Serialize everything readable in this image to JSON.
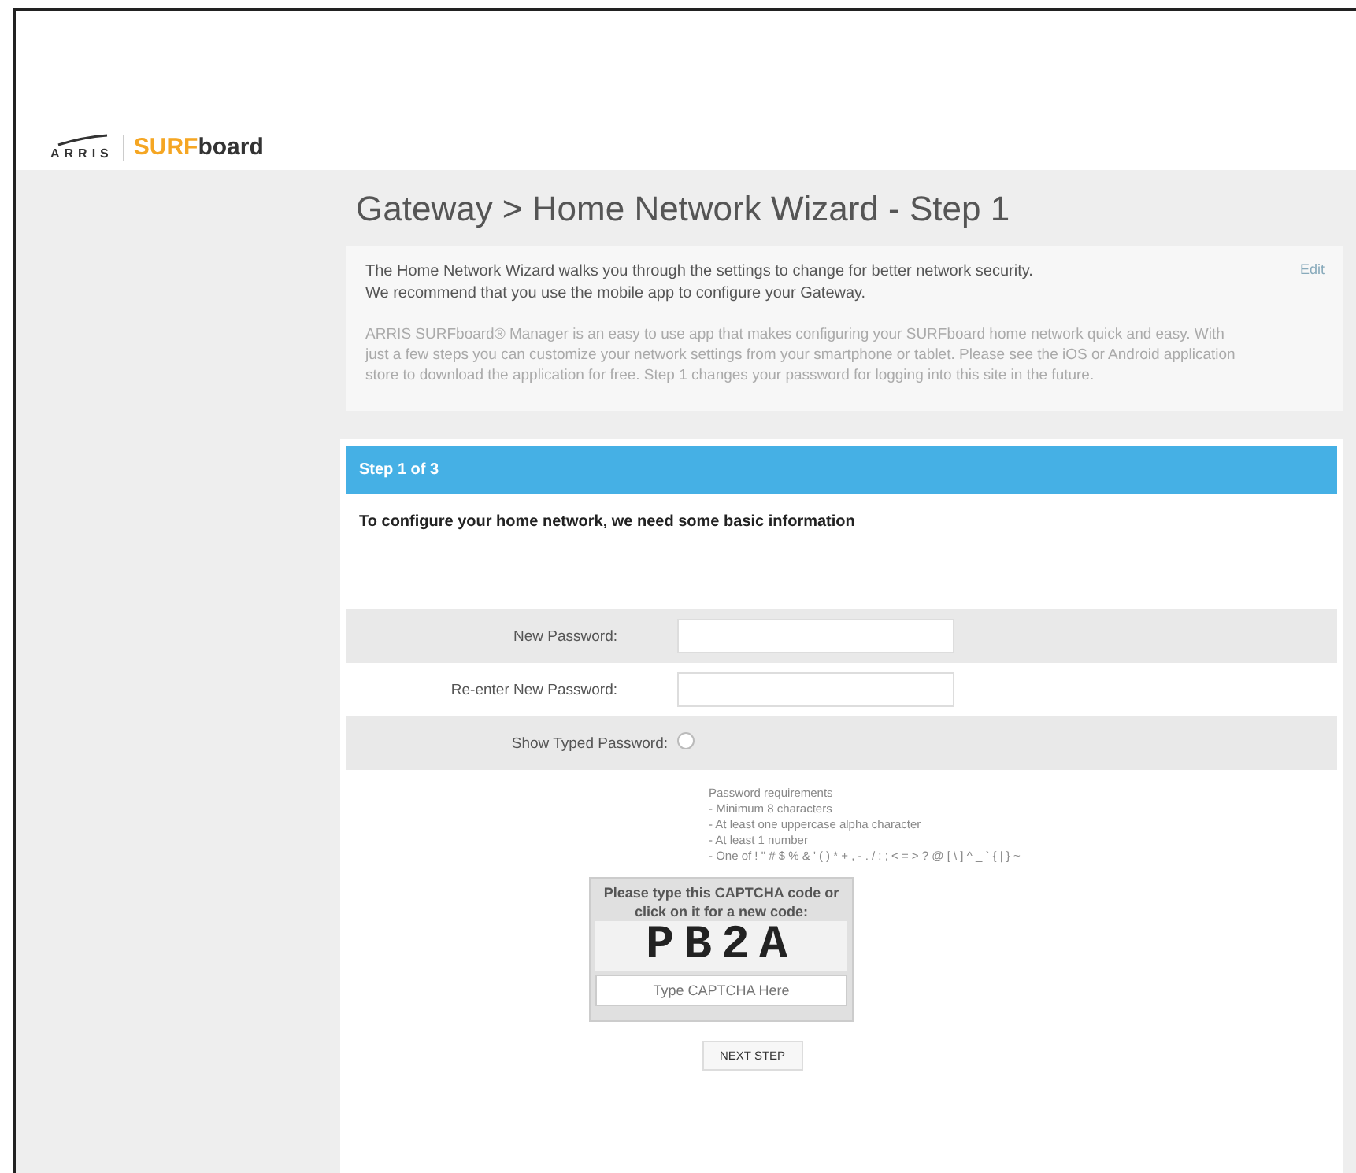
{
  "header": {
    "logo_left": "ARRIS",
    "logo_brand_highlight": "SURF",
    "logo_brand_rest": "board"
  },
  "page_title": "Gateway > Home Network Wizard - Step 1",
  "intro": {
    "link": "Edit",
    "lead": "The Home Network Wizard walks you through the settings to change for better network security.\nWe recommend that you use the mobile app to configure your Gateway.",
    "body": "ARRIS SURFboard® Manager is an easy to use app that makes configuring your SURFboard home network quick and easy. With just a few steps you can customize your network settings from your smartphone or tablet. Please see the iOS or Android application store to download the application for free. Step 1 changes your password for logging into this site in the future."
  },
  "wizard": {
    "step_title": "Step 1 of 3",
    "instruction": "To configure your home network, we need some basic information",
    "fields": [
      {
        "kind": "text",
        "label": "New Password:"
      },
      {
        "kind": "text",
        "label": "Re-enter New Password:"
      },
      {
        "kind": "checkbox",
        "label": "Show Typed Password:",
        "checked": false
      }
    ],
    "requirements": [
      "Password requirements",
      "- Minimum 8 characters",
      "- At least one uppercase alpha character",
      "- At least 1 number",
      "- One of ! \" # $ % & ' ( ) * + , - . / : ; < = > ? @ [ \\ ] ^ _ ` { | } ~"
    ],
    "captcha": {
      "prompt": "Please type this CAPTCHA code or click on it for a new code:",
      "code": "PB2A",
      "placeholder": "Type CAPTCHA Here"
    },
    "next_button": "NEXT STEP"
  }
}
